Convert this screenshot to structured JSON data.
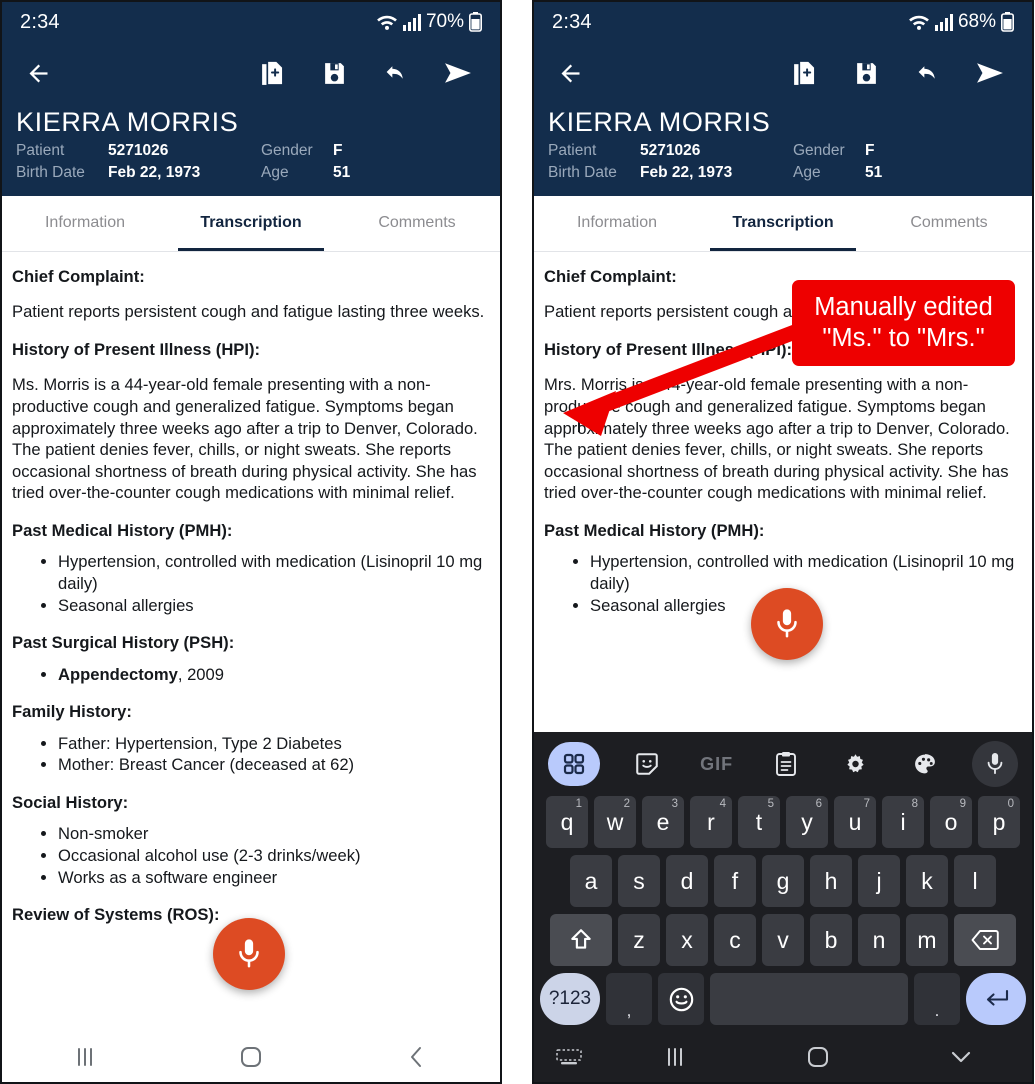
{
  "left_phone": {
    "status": {
      "time": "2:34",
      "battery": "70%",
      "wifi_icon": "wifi-icon",
      "signal_icon": "signal-bars-icon",
      "battery_icon": "battery-icon"
    },
    "appbar": {
      "back": "back-arrow-icon",
      "actions": [
        "add-document-icon",
        "save-icon",
        "undo-icon",
        "send-icon"
      ]
    },
    "patient": {
      "name": "KIERRA MORRIS",
      "patient_label": "Patient",
      "patient_value": "5271026",
      "gender_label": "Gender",
      "gender_value": "F",
      "birth_label": "Birth Date",
      "birth_value": "Feb 22, 1973",
      "age_label": "Age",
      "age_value": "51"
    },
    "tabs": [
      {
        "label": "Information",
        "active": false
      },
      {
        "label": "Transcription",
        "active": true
      },
      {
        "label": "Comments",
        "active": false
      }
    ],
    "doc": {
      "h_chief": "Chief Complaint:",
      "p_chief": "Patient reports persistent cough and fatigue lasting three weeks.",
      "h_hpi": "History of Present Illness (HPI):",
      "p_hpi": "Ms. Morris is a 44-year-old female presenting with a non-productive cough and generalized fatigue. Symptoms began approximately three weeks ago after a trip to Denver, Colorado. The patient denies fever, chills, or night sweats. She reports occasional shortness of breath during physical activity. She has tried over-the-counter cough medications with minimal relief.",
      "h_pmh": "Past Medical History (PMH):",
      "pmh_items": [
        "Hypertension, controlled with medication (Lisinopril 10 mg daily)",
        "Seasonal allergies"
      ],
      "h_psh": "Past Surgical History (PSH):",
      "psh_item_bold": "Appendectomy",
      "psh_item_rest": ", 2009",
      "h_family": "Family History:",
      "family_items": [
        "Father: Hypertension, Type 2 Diabetes",
        "Mother: Breast Cancer (deceased at 62)"
      ],
      "h_social": "Social History:",
      "social_items": [
        "Non-smoker",
        "Occasional alcohol use (2-3 drinks/week)",
        "Works as a software engineer"
      ],
      "h_ros": "Review of Systems (ROS):"
    },
    "fab": {
      "icon": "microphone-icon"
    },
    "navbar": {
      "recents": "recents-icon",
      "home": "home-icon",
      "back": "back-chevron-icon"
    }
  },
  "right_phone": {
    "status": {
      "time": "2:34",
      "battery": "68%",
      "wifi_icon": "wifi-icon",
      "signal_icon": "signal-bars-icon",
      "battery_icon": "battery-icon"
    },
    "appbar": {
      "back": "back-arrow-icon",
      "actions": [
        "add-document-icon",
        "save-icon",
        "undo-icon",
        "send-icon"
      ]
    },
    "patient": {
      "name": "KIERRA MORRIS",
      "patient_label": "Patient",
      "patient_value": "5271026",
      "gender_label": "Gender",
      "gender_value": "F",
      "birth_label": "Birth Date",
      "birth_value": "Feb 22, 1973",
      "age_label": "Age",
      "age_value": "51"
    },
    "tabs": [
      {
        "label": "Information",
        "active": false
      },
      {
        "label": "Transcription",
        "active": true
      },
      {
        "label": "Comments",
        "active": false
      }
    ],
    "doc": {
      "h_chief": "Chief Complaint:",
      "p_chief": "Patient reports persistent cough and fatigue lasting three weeks.",
      "h_hpi": "History of Present Illness (HPI):",
      "p_hpi": "Mrs. Morris is a 44-year-old female presenting with a non-productive cough and generalized fatigue. Symptoms began approximately three weeks ago after a trip to Denver, Colorado. The patient denies fever, chills, or night sweats. She reports occasional shortness of breath during physical activity. She has tried over-the-counter cough medications with minimal relief.",
      "h_pmh": "Past Medical History (PMH):",
      "pmh_items": [
        "Hypertension, controlled with medication (Lisinopril 10 mg daily)",
        "Seasonal allergies"
      ]
    },
    "fab": {
      "icon": "microphone-icon"
    },
    "keyboard": {
      "toolbar": [
        "apps-grid-icon",
        "sticker-icon",
        "gif-icon",
        "clipboard-icon",
        "settings-gear-icon",
        "palette-icon",
        "microphone-icon"
      ],
      "gif_label": "GIF",
      "row1": [
        {
          "k": "q",
          "n": "1"
        },
        {
          "k": "w",
          "n": "2"
        },
        {
          "k": "e",
          "n": "3"
        },
        {
          "k": "r",
          "n": "4"
        },
        {
          "k": "t",
          "n": "5"
        },
        {
          "k": "y",
          "n": "6"
        },
        {
          "k": "u",
          "n": "7"
        },
        {
          "k": "i",
          "n": "8"
        },
        {
          "k": "o",
          "n": "9"
        },
        {
          "k": "p",
          "n": "0"
        }
      ],
      "row2": [
        "a",
        "s",
        "d",
        "f",
        "g",
        "h",
        "j",
        "k",
        "l"
      ],
      "row3": [
        "z",
        "x",
        "c",
        "v",
        "b",
        "n",
        "m"
      ],
      "shift_icon": "shift-icon",
      "backspace_icon": "backspace-icon",
      "symbols_label": "?123",
      "comma_label": ",",
      "emoji_icon": "emoji-smiley-icon",
      "space_label": "",
      "period_label": ".",
      "enter_icon": "enter-return-icon"
    },
    "navbar": {
      "keyboard": "keyboard-icon",
      "recents": "recents-icon",
      "home": "home-icon",
      "hide": "chevron-down-icon"
    }
  },
  "annotation": {
    "text": "Manually edited \"Ms.\" to \"Mrs.\"",
    "color": "#ee0000",
    "arrow_icon": "pointer-arrow-icon"
  },
  "theme": {
    "header_navy": "#132d4c",
    "accent_orange": "#dd4b23",
    "annotation_red": "#ee0000",
    "keyboard_bg": "#1d1e22",
    "key_bg": "#3a3c42",
    "enter_blue": "#b9cafc"
  }
}
